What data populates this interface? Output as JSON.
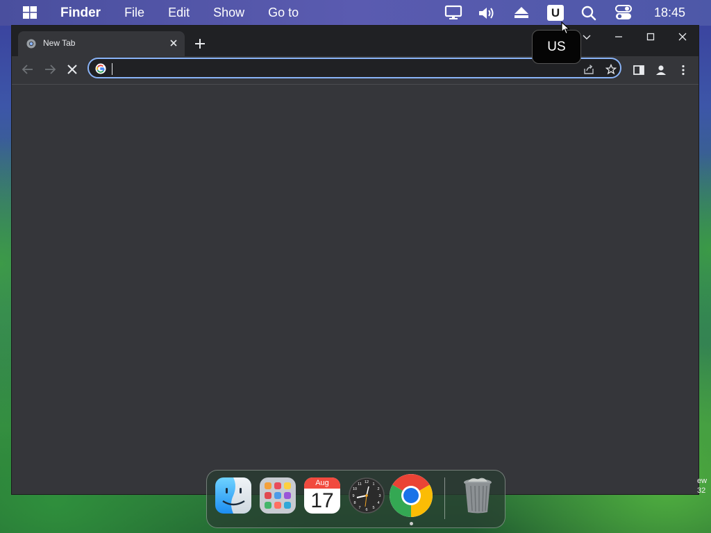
{
  "menubar": {
    "app_name": "Finder",
    "menus": [
      "File",
      "Edit",
      "Show",
      "Go to"
    ],
    "status_icons": [
      "display-icon",
      "volume-icon",
      "eject-icon",
      "input-source-icon",
      "search-icon",
      "control-center-icon"
    ],
    "input_source_letter": "U",
    "clock": "18:45"
  },
  "tooltip": {
    "text": "US"
  },
  "browser": {
    "tab": {
      "title": "New Tab"
    },
    "omnibox": {
      "value": "",
      "placeholder": ""
    }
  },
  "dock": {
    "items": [
      {
        "name": "Finder",
        "icon": "finder-icon"
      },
      {
        "name": "Launchpad",
        "icon": "launchpad-icon"
      },
      {
        "name": "Calendar",
        "icon": "calendar-icon"
      },
      {
        "name": "Clock",
        "icon": "clock-icon"
      },
      {
        "name": "Google Chrome",
        "icon": "chrome-icon"
      },
      {
        "name": "Trash",
        "icon": "trash-icon"
      }
    ],
    "calendar_month": "Aug",
    "calendar_day": "17"
  },
  "desktop_partial_text": [
    "ew",
    "32"
  ],
  "colors": {
    "menubar": "#4d58a8",
    "tabstrip": "#202124",
    "window": "#35363a",
    "omnibox_focus": "#8ab4f8"
  }
}
